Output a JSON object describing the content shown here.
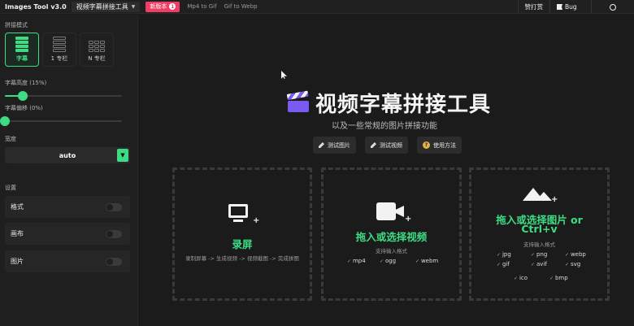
{
  "topbar": {
    "app_title": "Images Tool v3.0",
    "tool_select": "视频字幕拼接工具",
    "new_badge": {
      "label": "新版本",
      "count": "1"
    },
    "links": [
      "Mp4 to Gif",
      "Gif to Webp"
    ],
    "donate": "赞打赏",
    "bug": "Bug"
  },
  "sidebar": {
    "mode_label": "拼接模式",
    "modes": [
      {
        "label": "字幕",
        "active": true
      },
      {
        "label": "1 专栏",
        "active": false
      },
      {
        "label": "N 专栏",
        "active": false
      }
    ],
    "subtitle_height": {
      "label": "字幕高度 (15%)",
      "value_percent": 15
    },
    "subtitle_offset": {
      "label": "字幕偏移 (0%)",
      "value_percent": 0
    },
    "width": {
      "label": "宽度",
      "value": "auto"
    },
    "settings_label": "设置",
    "settings": [
      "格式",
      "画布",
      "图片"
    ]
  },
  "main": {
    "title": "视频字幕拼接工具",
    "subtitle": "以及一些常规的图片拼接功能",
    "buttons": [
      "测试图片",
      "测试视频",
      "使用方法"
    ],
    "cards": [
      {
        "title": "录屏",
        "desc": "录制屏幕 -> 生成视频 -> 视频截图 -> 完成拼图",
        "formats_label": "",
        "formats": []
      },
      {
        "title": "拖入或选择视频",
        "desc": "",
        "formats_label": "支持输入格式",
        "formats": [
          "mp4",
          "ogg",
          "webm"
        ]
      },
      {
        "title_line1": "拖入或选择图片 or",
        "title_line2": "Ctrl+v",
        "desc": "",
        "formats_label": "支持输入格式",
        "formats": [
          "jpg",
          "png",
          "webp",
          "gif",
          "avif",
          "svg",
          "ico",
          "bmp"
        ]
      }
    ]
  },
  "colors": {
    "accent": "#3ddc84",
    "badge": "#ef3d66",
    "background": "#1b1b1b"
  }
}
